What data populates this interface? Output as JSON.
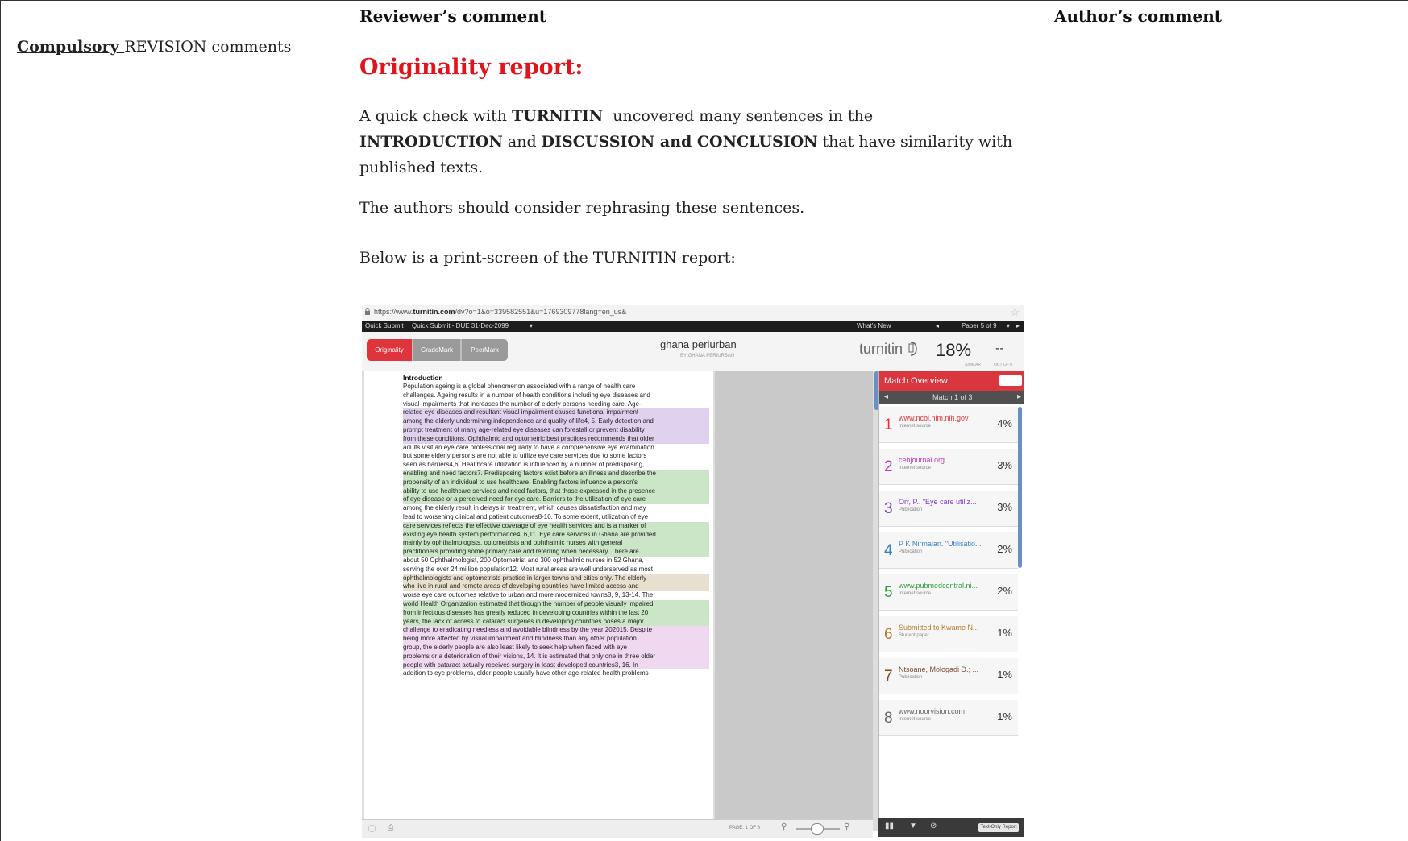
{
  "table": {
    "header_reviewer": "Reviewer’s comment",
    "header_author": "Author’s comment",
    "row_label_bold": "Compulsory ",
    "row_label_rest": "REVISION comments"
  },
  "review": {
    "heading": "Originality report:",
    "p1_a": "A quick check with ",
    "p1_b": "TURNITIN",
    "p1_c": "  uncovered many sentences in the",
    "p1_d": "INTRODUCTION",
    "p1_e": " and ",
    "p1_f": "DISCUSSION and CONCLUSION",
    "p1_g": " that have similarity with",
    "p1_h": "published texts.",
    "p2": "The authors should consider rephrasing these sentences.",
    "p3": "Below is a print-screen of the TURNITIN report:"
  },
  "shot": {
    "url_prefix": "https://www.",
    "url_domain": "turnitin.com",
    "url_rest": "/dv?o=1&o=339582551&u=1769309778lang=en_us&",
    "quick_submit": "Quick Submit",
    "quick_submit_due": "Quick Submit - DUE 31-Dec-2099",
    "whats_new": "What's New",
    "paper_of": "Paper 5 of 9",
    "tab_originality": "Originality",
    "tab_grademark": "GradeMark",
    "tab_peermark": "PeerMark",
    "doc_title": "ghana periurban",
    "doc_by": "BY GHANA PERIURBAN",
    "logo": "turnitin",
    "similarity": "18%",
    "similar_label": "SIMILAR",
    "out_of_value": "--",
    "out_of_label": "OUT OF 0",
    "intro_title": "Introduction",
    "page_label": "PAGE: 1 OF 8",
    "text_only": "Text-Only Report"
  },
  "panel": {
    "title": "Match Overview",
    "nav": "Match 1 of 3",
    "matches": [
      {
        "n": "1",
        "src": "www.ncbi.nlm.nih.gov",
        "type": "Internet source",
        "pct": "4%",
        "color": "#e0343c"
      },
      {
        "n": "2",
        "src": "cehjournal.org",
        "type": "Internet source",
        "pct": "3%",
        "color": "#c03bb8"
      },
      {
        "n": "3",
        "src": "Orr, P.. \"Eye care utiliz...",
        "type": "Publication",
        "pct": "3%",
        "color": "#7b3fc2"
      },
      {
        "n": "4",
        "src": "P K Nirmalan. \"Utilisatio...",
        "type": "Publication",
        "pct": "2%",
        "color": "#3b7fc4"
      },
      {
        "n": "5",
        "src": "www.pubmedcentral.ni...",
        "type": "Internet source",
        "pct": "2%",
        "color": "#2f9c3c"
      },
      {
        "n": "6",
        "src": "Submitted to Kwame N...",
        "type": "Student paper",
        "pct": "1%",
        "color": "#b27a2a"
      },
      {
        "n": "7",
        "src": "Ntsoane, Mologadi D.; ...",
        "type": "Publication",
        "pct": "1%",
        "color": "#7a4a2e"
      },
      {
        "n": "8",
        "src": "www.noorvision.com",
        "type": "Internet source",
        "pct": "1%",
        "color": "#666666"
      }
    ]
  },
  "paper_text": {
    "l1": "Population ageing is a global phenomenon associated with a range of health care",
    "l2": "challenges. Ageing results in a number of health conditions including eye diseases and",
    "l3": "visual impairments that increases the number of elderly persons needing care. Age-",
    "l4": "related eye diseases and resultant visual impairment causes functional impairment",
    "l5": "among the elderly undermining independence and quality of life4, 5. Early detection and",
    "l6": "prompt treatment of many age-related eye diseases can forestall or prevent disability",
    "l7": "from these conditions. Ophthalmic and optometric best practices recommends that older",
    "l8": "adults visit an eye care professional regularly to have a comprehensive eye examination",
    "l9": "but some elderly persons are not able to utilize eye care services due to some factors",
    "l10": "seen as barriers4,6. Healthcare utilization is influenced by a number of predisposing,",
    "l11": "enabling and need factors7. Predisposing factors exist before an illness and describe the",
    "l12": "propensity of an individual to use healthcare. Enabling factors influence a person's",
    "l13": "ability to use healthcare services and need factors, that those expressed in the presence",
    "l14": "of eye disease or a perceived need for eye care. Barriers to the utilization of eye care",
    "l15": "among the elderly result in delays in treatment, which causes dissatisfaction and may",
    "l16": "lead to worsening clinical and patient outcomes8-10. To some extent, utilization of eye",
    "l17": "care services reflects the effective coverage of eye health services and is a marker of",
    "l18": "existing eye health system performance4, 6,11. Eye care services in Ghana are provided",
    "l19": "mainly by ophthalmologists, optometrists and ophthalmic nurses with general",
    "l20": "practitioners providing some primary care and referring when necessary. There are",
    "l21": "about 50 Ophthalmologist, 200 Optometrist and 300 ophthalmic nurses in 52 Ghana,",
    "l22": "serving the over 24 million population12. Most rural areas are well underserved as most",
    "l23": "ophthalmologists and optometrists practice in larger towns and cities only. The elderly",
    "l24": "who live in rural and remote areas of developing countries have limited access and",
    "l25": "worse eye care outcomes relative to urban and more modernized towns8, 9, 13-14. The",
    "l26": "world Health Organization estimated that though the number of people visually impaired",
    "l27": "from infectious diseases has greatly reduced in developing countries within the last 20",
    "l28": "years, the lack of access to cataract surgeries in developing countries poses a major",
    "l29": "challenge to eradicating needless and avoidable blindness by the year 202015. Despite",
    "l30": "being more affected by visual impairment and blindness than any other population",
    "l31": "group, the elderly people are also least likely to seek help when faced with eye",
    "l32": "problems or a deterioration of their visions, 14. It is estimated that only one in three older",
    "l33": "people with cataract actually receives surgery in least developed countries3, 16. In",
    "l34": "addition to eye problems, older people usually have other age-related health problems"
  }
}
